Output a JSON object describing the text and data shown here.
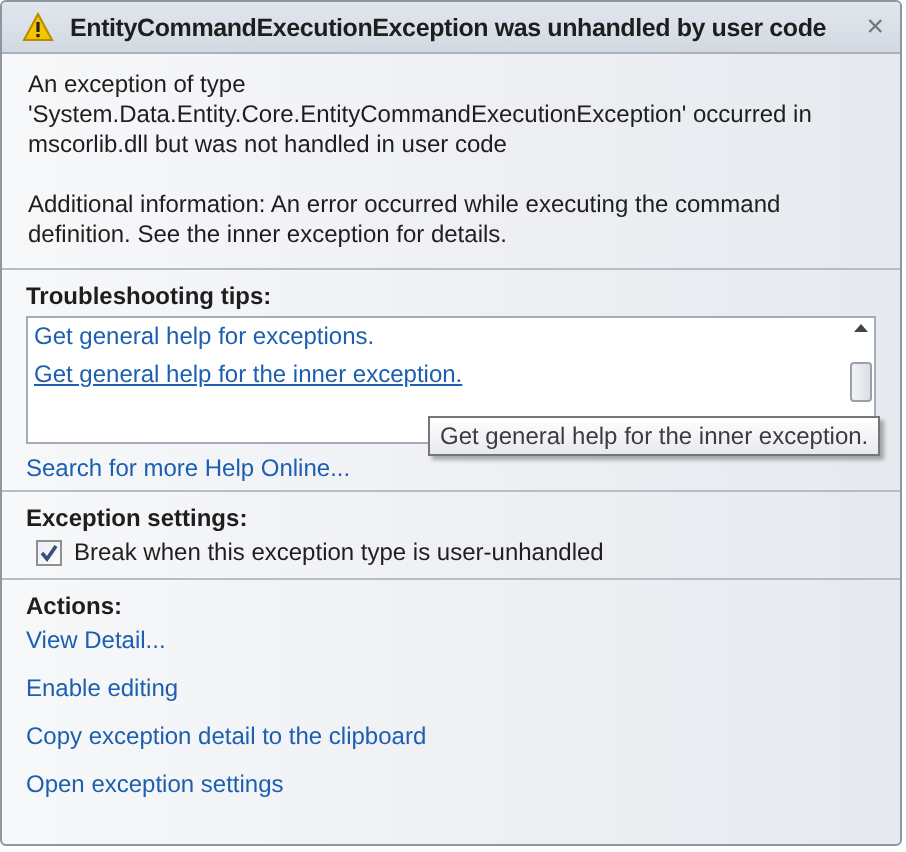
{
  "dialog": {
    "title": "EntityCommandExecutionException was unhandled by user code",
    "close": "×",
    "message": [
      "An exception of type 'System.Data.Entity.Core.EntityCommandExecutionException' occurred in mscorlib.dll but was not handled in user code",
      "Additional information: An error occurred while executing the command definition. See the inner exception for details."
    ]
  },
  "troubleshooting": {
    "heading": "Troubleshooting tips:",
    "tips": [
      {
        "label": "Get general help for exceptions.",
        "hovered": false
      },
      {
        "label": "Get general help for the inner exception.",
        "hovered": true
      }
    ],
    "tooltip": "Get general help for the inner exception.",
    "search_link": "Search for more Help Online..."
  },
  "exception_settings": {
    "heading": "Exception settings:",
    "checkbox": {
      "label": "Break when this exception type is user-unhandled",
      "checked": true
    }
  },
  "actions": {
    "heading": "Actions:",
    "links": [
      "View Detail...",
      "Enable editing",
      "Copy exception detail to the clipboard",
      "Open exception settings"
    ]
  }
}
